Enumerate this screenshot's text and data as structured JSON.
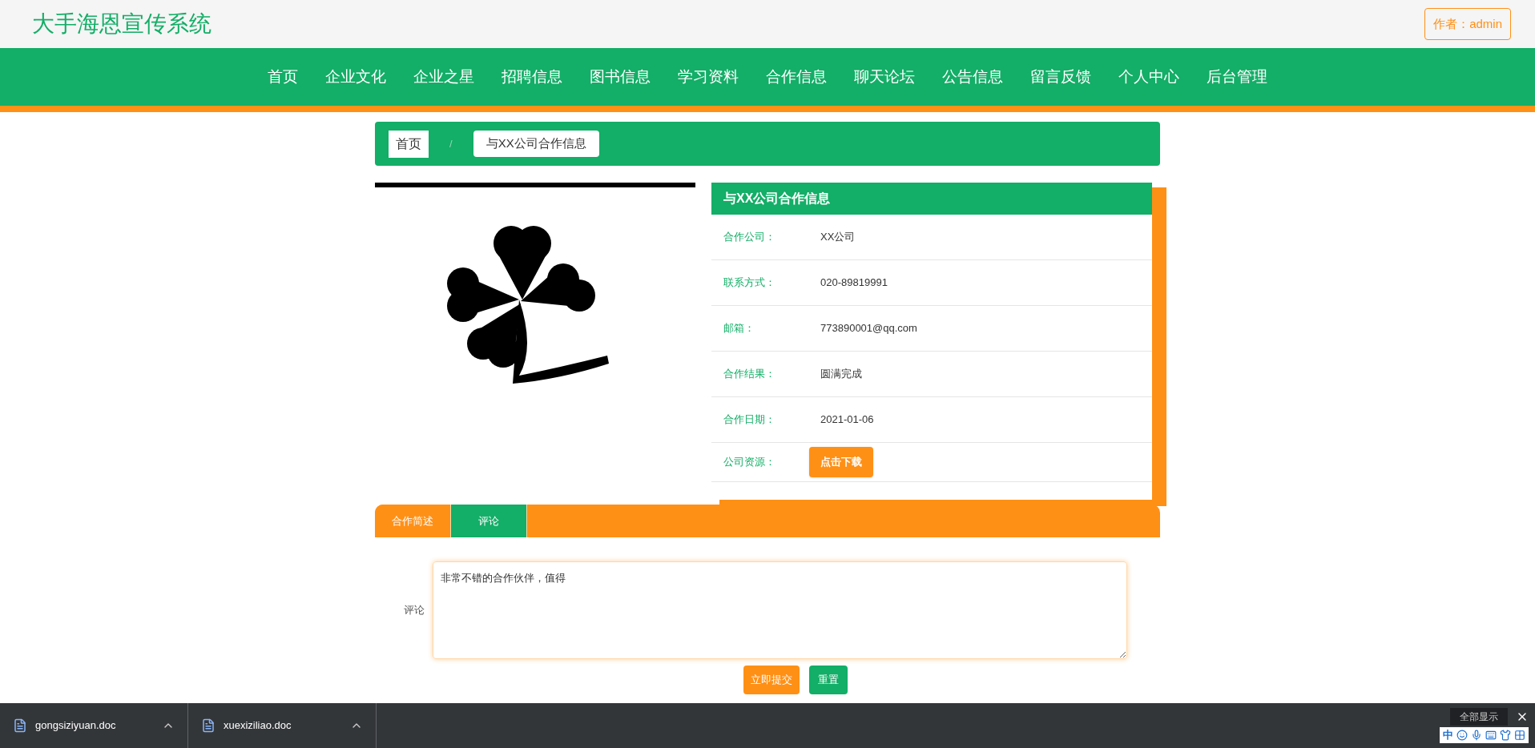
{
  "site_title": "大手海恩宣传系统",
  "author": "作者：admin",
  "nav": [
    "首页",
    "企业文化",
    "企业之星",
    "招聘信息",
    "图书信息",
    "学习资料",
    "合作信息",
    "聊天论坛",
    "公告信息",
    "留言反馈",
    "个人中心",
    "后台管理"
  ],
  "breadcrumb": {
    "home": "首页",
    "separator": "/",
    "current": "与XX公司合作信息"
  },
  "info": {
    "title": "与XX公司合作信息",
    "rows": [
      {
        "label": "合作公司：",
        "value": "XX公司"
      },
      {
        "label": "联系方式：",
        "value": "020-89819991"
      },
      {
        "label": "邮箱：",
        "value": "773890001@qq.com"
      },
      {
        "label": "合作结果：",
        "value": "圆满完成"
      },
      {
        "label": "合作日期：",
        "value": "2021-01-06"
      }
    ],
    "resource": {
      "label": "公司资源：",
      "button": "点击下载"
    }
  },
  "tabs": [
    {
      "label": "合作简述",
      "selected": false
    },
    {
      "label": "评论",
      "selected": true
    }
  ],
  "comment": {
    "label": "评论",
    "value": "非常不错的合作伙伴，值得",
    "submit": "立即提交",
    "reset": "重置"
  },
  "downloads": [
    {
      "name": "gongsiziyuan.doc"
    },
    {
      "name": "xuexiziliao.doc"
    }
  ],
  "tray": {
    "ime": "中",
    "show_all": "全部显示"
  }
}
